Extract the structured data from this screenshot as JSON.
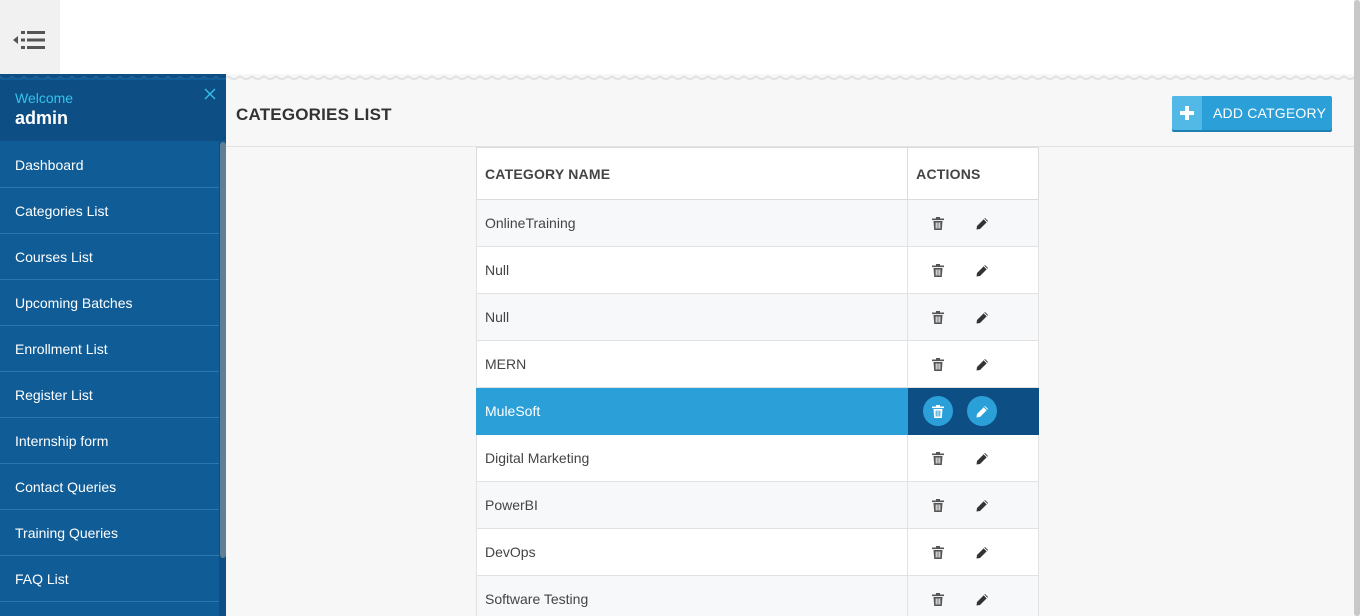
{
  "sidebar": {
    "welcome": "Welcome",
    "user": "admin",
    "items": [
      {
        "label": "Dashboard"
      },
      {
        "label": "Categories List"
      },
      {
        "label": "Courses List"
      },
      {
        "label": "Upcoming Batches"
      },
      {
        "label": "Enrollment List"
      },
      {
        "label": "Register List"
      },
      {
        "label": "Internship form"
      },
      {
        "label": "Contact Queries"
      },
      {
        "label": "Training Queries"
      },
      {
        "label": "FAQ List"
      }
    ]
  },
  "header": {
    "title": "CATEGORIES LIST",
    "add_button": "ADD CATGEORY"
  },
  "table": {
    "columns": [
      "CATEGORY NAME",
      "ACTIONS"
    ],
    "rows": [
      {
        "name": "OnlineTraining"
      },
      {
        "name": "Null"
      },
      {
        "name": "Null"
      },
      {
        "name": "MERN"
      },
      {
        "name": "MuleSoft",
        "selected": true
      },
      {
        "name": "Digital Marketing"
      },
      {
        "name": "PowerBI"
      },
      {
        "name": "DevOps"
      },
      {
        "name": "Software Testing"
      }
    ]
  },
  "colors": {
    "sidebar": "#0f5c96",
    "sidebar_header": "#0d4f84",
    "accent": "#2a9fd8",
    "welcome_text": "#34c2ee"
  },
  "icons": {
    "menu": "menu-collapse-icon",
    "close": "close-icon",
    "add": "plus-icon",
    "delete": "trash-icon",
    "edit": "pencil-icon"
  }
}
